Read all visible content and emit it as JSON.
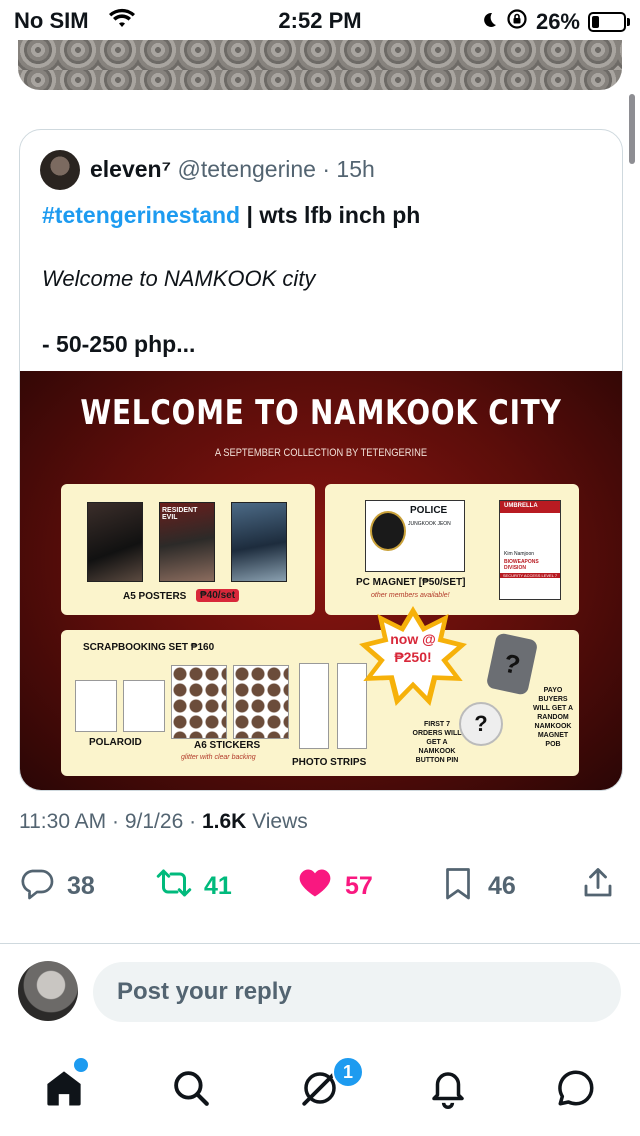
{
  "status_bar": {
    "carrier": "No SIM",
    "time": "2:52 PM",
    "battery_percent": "26%",
    "battery_level": 0.26
  },
  "quote": {
    "author_name": "eleven⁷",
    "handle": "@tetengerine",
    "separator": "·",
    "age": "15h",
    "hashtag": "#tetengerinestand",
    "text_rest": " | wts lfb inch ph",
    "line2": "Welcome to NAMKOOK city",
    "line3": "- 50-250 php..."
  },
  "promo_image": {
    "title": "WELCOME TO NAMKOOK CITY",
    "subtitle": "A SEPTEMBER COLLECTION BY TETENGERINE",
    "posters_label": "A5 POSTERS",
    "posters_price": "₱40/set",
    "poster_text": "RESIDENT EVIL",
    "magnet_label": "PC MAGNET [₱50/SET]",
    "magnet_note": "other members available!",
    "police_label": "POLICE",
    "police_name": "JUNGKOOK JEON",
    "umbrella_label": "UMBRELLA",
    "umbrella_id_name": "Kim Namjoon",
    "umbrella_division": "BIOWEAPONS DIVISION",
    "umbrella_access": "SECURITY ACCESS LEVEL 7",
    "scrapbook_label": "SCRAPBOOKING SET ₱160",
    "now_label": "now @",
    "now_price": "₱250!",
    "polaroid_label": "POLAROID",
    "stickers_label": "A6 STICKERS",
    "stickers_note": "glitter with clear backing",
    "strips_label": "PHOTO STRIPS",
    "first7_note": "FIRST 7 ORDERS WILL GET A NAMKOOK BUTTON PIN",
    "payo_note": "PAYO BUYERS WILL GET A RANDOM NAMKOOK MAGNET POB",
    "mystery_mark": "?"
  },
  "meta": {
    "time": "11:30 AM",
    "date": "9/1/26",
    "views_count": "1.6K",
    "views_label": "Views",
    "sep": "·"
  },
  "actions": {
    "replies": "38",
    "reposts": "41",
    "likes": "57",
    "bookmarks": "46"
  },
  "reply_placeholder": "Post your reply",
  "tabbar": {
    "messages_badge": "1"
  },
  "colors": {
    "accent": "#1d9bf0",
    "repost": "#00ba7c",
    "like": "#f91880",
    "muted": "#536471"
  }
}
